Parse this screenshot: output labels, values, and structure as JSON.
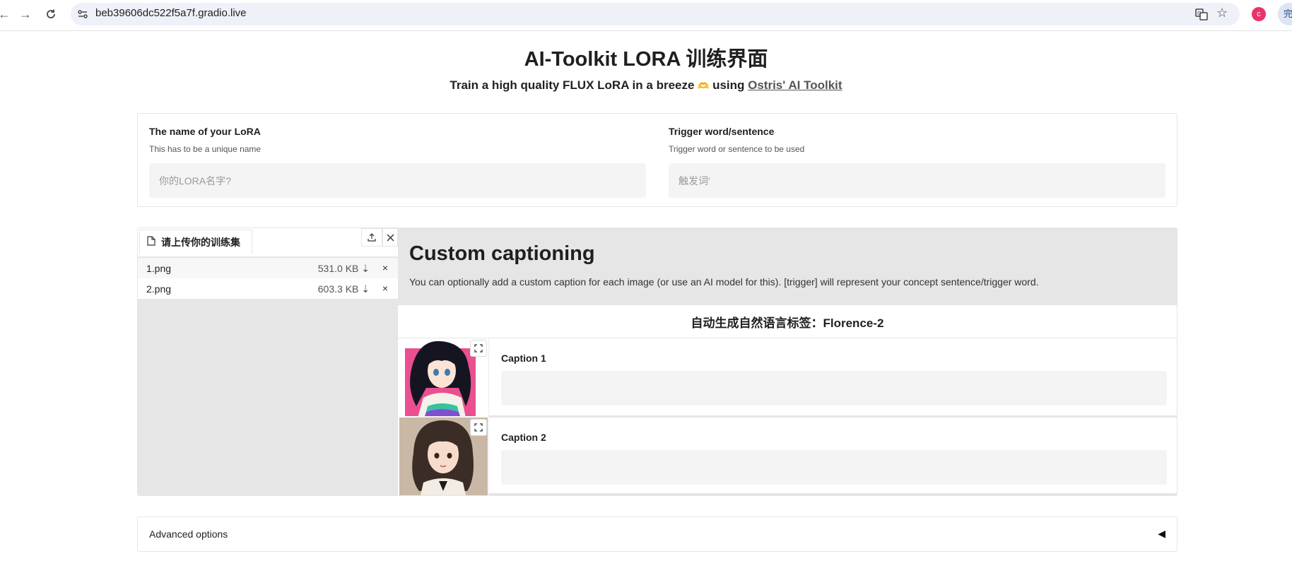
{
  "browser": {
    "url": "beb39606dc522f5a7f.gradio.live",
    "avatar_letter": "c",
    "edge_label": "完"
  },
  "header": {
    "title": "AI-Toolkit LORA 训练界面",
    "subtitle_prefix": "Train a high quality FLUX LoRA in a breeze ",
    "subtitle_emoji": "🫶",
    "subtitle_mid": " using ",
    "subtitle_link": "Ostris' AI Toolkit"
  },
  "lora_name": {
    "label": "The name of your LoRA",
    "info": "This has to be a unique name",
    "placeholder": "你的LORA名字?",
    "value": ""
  },
  "trigger": {
    "label": "Trigger word/sentence",
    "info": "Trigger word or sentence to be used",
    "placeholder": "触发词'",
    "value": ""
  },
  "upload": {
    "tab_label": "请上传你的训练集",
    "files": [
      {
        "name": "1.png",
        "size": "531.0 KB",
        "download": "⇣",
        "remove": "×"
      },
      {
        "name": "2.png",
        "size": "603.3 KB",
        "download": "⇣",
        "remove": "×"
      }
    ]
  },
  "captioning": {
    "title": "Custom captioning",
    "description": "You can optionally add a custom caption for each image (or use an AI model for this). [trigger] will represent your concept sentence/trigger word.",
    "auto_button": "自动生成自然语言标签：Florence-2",
    "captions": [
      {
        "label": "Caption 1",
        "value": ""
      },
      {
        "label": "Caption 2",
        "value": ""
      }
    ]
  },
  "advanced": {
    "label": "Advanced options",
    "caret": "◀"
  },
  "colors": {
    "accent_pink": "#e8336b",
    "panel_gray": "#e6e6e6",
    "input_gray": "#f4f4f4"
  }
}
